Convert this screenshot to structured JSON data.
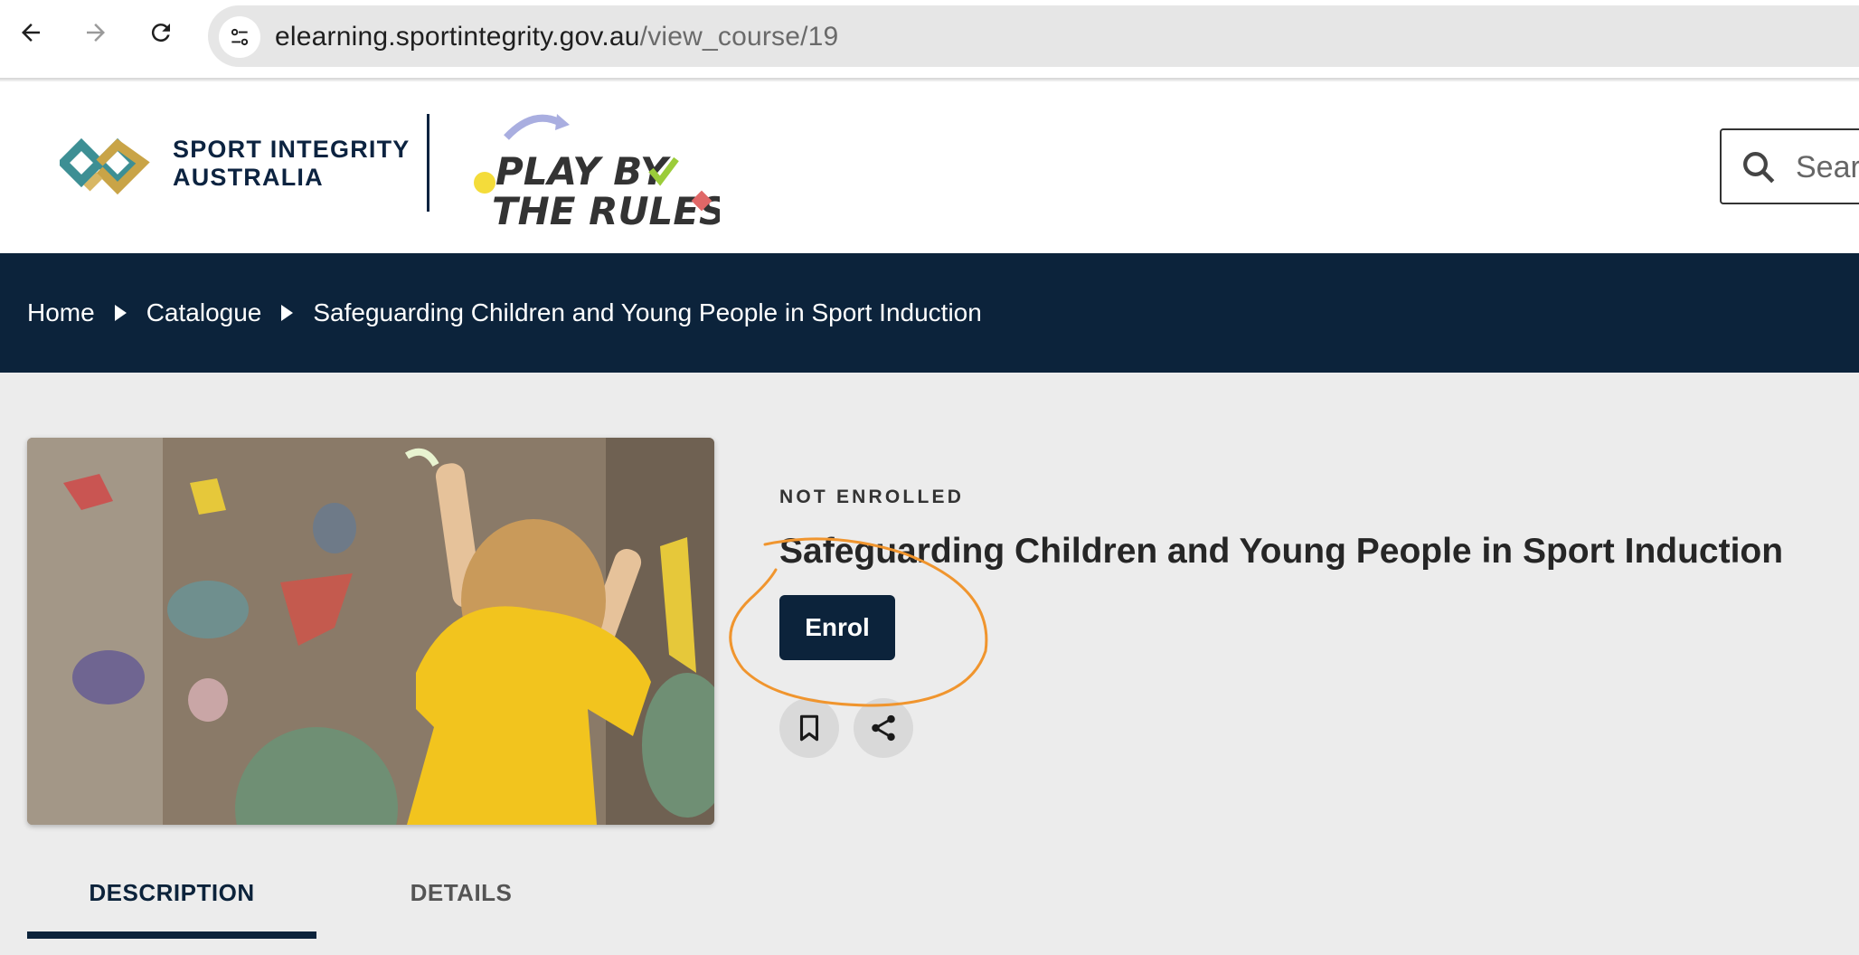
{
  "browser": {
    "url_host": "elearning.sportintegrity.gov.au",
    "url_path": "/view_course/19"
  },
  "header": {
    "org_name_line1": "SPORT INTEGRITY",
    "org_name_line2": "AUSTRALIA",
    "program_logo_line1": "PLAY BY",
    "program_logo_line2": "THE RULES",
    "search_placeholder": "Search"
  },
  "breadcrumb": {
    "items": [
      "Home",
      "Catalogue",
      "Safeguarding Children and Young People in Sport Induction"
    ]
  },
  "course": {
    "status": "NOT ENROLLED",
    "title": "Safeguarding Children and Young People in Sport Induction",
    "enrol_label": "Enrol"
  },
  "tabs": [
    {
      "label": "DESCRIPTION",
      "active": true
    },
    {
      "label": "DETAILS",
      "active": false
    }
  ],
  "colors": {
    "navy": "#0c233b",
    "annotation": "#f0952e",
    "shirt": "#f2c41e"
  }
}
